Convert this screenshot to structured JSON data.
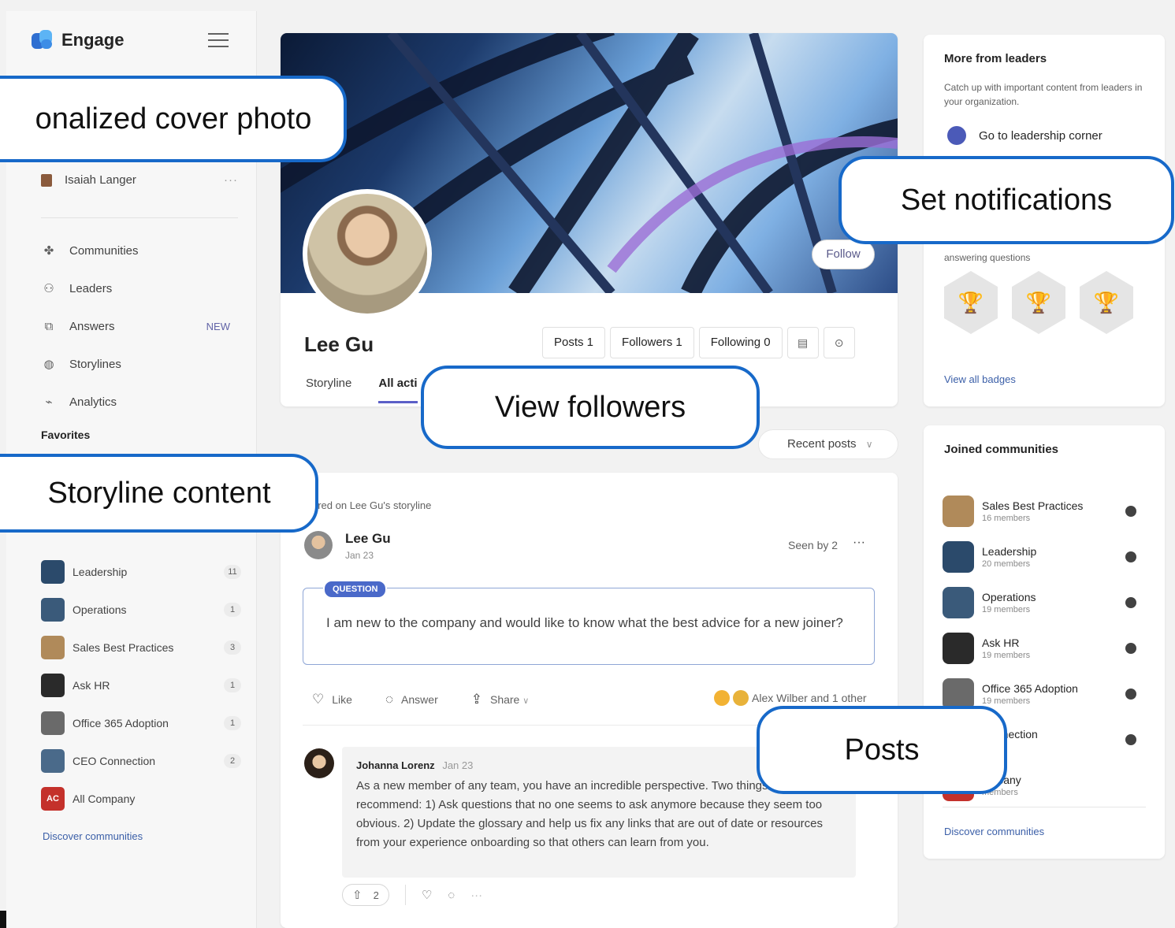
{
  "app": {
    "name": "Engage"
  },
  "sidebar": {
    "user": "Isaiah Langer",
    "user_more": "···",
    "nav": [
      {
        "label": "Communities",
        "icon": "communities-icon",
        "glyph": "✤",
        "badge": ""
      },
      {
        "label": "Leaders",
        "icon": "leaders-icon",
        "glyph": "⚇",
        "badge": ""
      },
      {
        "label": "Answers",
        "icon": "answers-icon",
        "glyph": "⧉",
        "badge": "NEW"
      },
      {
        "label": "Storylines",
        "icon": "storylines-icon",
        "glyph": "◍",
        "badge": ""
      },
      {
        "label": "Analytics",
        "icon": "analytics-icon",
        "glyph": "⌁",
        "badge": ""
      }
    ],
    "favorites_title": "Favorites",
    "communities": [
      {
        "name": "Leadership",
        "count": "11",
        "color": "#2b4a6b"
      },
      {
        "name": "Operations",
        "count": "1",
        "color": "#3a5a7a"
      },
      {
        "name": "Sales Best Practices",
        "count": "3",
        "color": "#b08a5a"
      },
      {
        "name": "Ask HR",
        "count": "1",
        "color": "#2a2a2a"
      },
      {
        "name": "Office 365 Adoption",
        "count": "1",
        "color": "#6a6a6a"
      },
      {
        "name": "CEO Connection",
        "count": "2",
        "color": "#4a6a8a"
      },
      {
        "name": "All Company",
        "count": "",
        "color": "#c4312b",
        "initials": "AC"
      }
    ],
    "discover": "Discover communities"
  },
  "profile": {
    "name": "Lee Gu",
    "follow": "Follow",
    "stats": {
      "posts": "Posts 1",
      "followers": "Followers 1",
      "following": "Following 0"
    },
    "tabs": [
      "Storyline",
      "All acti"
    ]
  },
  "feed": {
    "sort": "Recent posts",
    "shared": "ared on Lee Gu's storyline",
    "post": {
      "author": "Lee Gu",
      "date": "Jan 23",
      "seen": "Seen by 2",
      "more": "···",
      "tag": "QUESTION",
      "text": "I am new to the company and would like to know what the best advice for a new joiner?",
      "actions": {
        "like": "Like",
        "answer": "Answer",
        "share": "Share"
      },
      "reactions": "Alex Wilber and 1 other"
    },
    "reply": {
      "author": "Johanna Lorenz",
      "date": "Jan 23",
      "text": "As a new member of any team, you have an incredible perspective. Two things I'd recommend: 1) Ask questions that no one seems to ask anymore because they seem too obvious. 2) Update the glossary and help us fix any links that are out of date or resources from your experience onboarding so that others can learn from you.",
      "upvotes": "2",
      "more": "···"
    }
  },
  "right": {
    "leaders": {
      "title": "More from leaders",
      "desc": "Catch up with important content from leaders in your organization.",
      "link": "Go to leadership corner"
    },
    "badges": {
      "desc": "answering questions",
      "view_all": "View all badges"
    },
    "joined": {
      "title": "Joined communities",
      "items": [
        {
          "name": "Sales Best Practices",
          "members": "16 members",
          "color": "#b08a5a"
        },
        {
          "name": "Leadership",
          "members": "20 members",
          "color": "#2b4a6b"
        },
        {
          "name": "Operations",
          "members": "19 members",
          "color": "#3a5a7a"
        },
        {
          "name": "Ask HR",
          "members": "19 members",
          "color": "#2a2a2a"
        },
        {
          "name": "Office 365 Adoption",
          "members": "19 members",
          "color": "#6a6a6a"
        },
        {
          "name": "Connection",
          "members": "bers",
          "color": "#4a6a8a"
        },
        {
          "name": "ompany",
          "members": "members",
          "color": "#c4312b"
        }
      ],
      "discover": "Discover communities"
    }
  },
  "callouts": {
    "cover": "onalized cover photo",
    "notifications": "Set notifications",
    "followers": "View followers",
    "storyline": "Storyline content",
    "posts": "Posts"
  },
  "colors": {
    "accent": "#5b5fc7",
    "callout_border": "#1769c9",
    "link": "#3b5fa8"
  }
}
